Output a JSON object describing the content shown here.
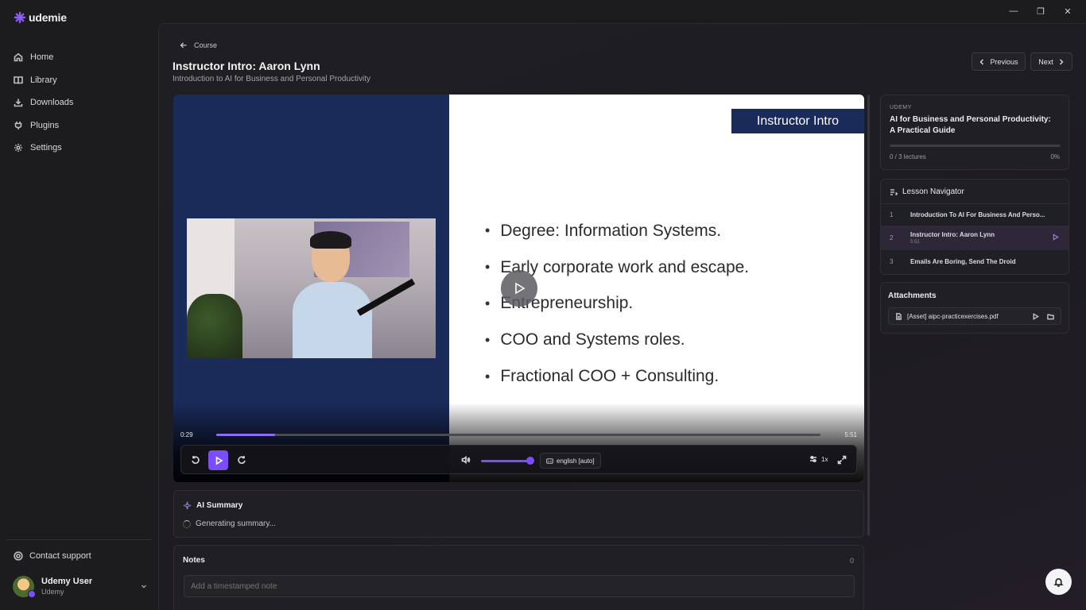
{
  "app": {
    "name": "udemie",
    "brand_color": "#7c4dff"
  },
  "window_controls": {
    "minimize": "—",
    "restore": "❐",
    "close": "✕"
  },
  "sidebar": {
    "items": [
      {
        "label": "Home",
        "icon": "home-icon"
      },
      {
        "label": "Library",
        "icon": "book-icon"
      },
      {
        "label": "Downloads",
        "icon": "download-icon"
      },
      {
        "label": "Plugins",
        "icon": "plug-icon"
      },
      {
        "label": "Settings",
        "icon": "gear-icon"
      }
    ],
    "support_label": "Contact support",
    "user": {
      "name": "Udemy User",
      "sub": "Udemy"
    }
  },
  "header": {
    "breadcrumb": "Course",
    "title": "Instructor Intro: Aaron Lynn",
    "subtitle": "Introduction to AI for Business and Personal Productivity",
    "prev_label": "Previous",
    "next_label": "Next"
  },
  "player": {
    "slide_banner": "Instructor Intro",
    "bullets": [
      "Degree: Information Systems.",
      "Early corporate work and escape.",
      "Entrepreneurship.",
      "COO and Systems roles.",
      "Fractional COO + Consulting."
    ],
    "current_time": "0:29",
    "duration": "5:51",
    "progress": 0.097,
    "volume": 1.0,
    "language": "english [auto]",
    "speed": "1x"
  },
  "ai_summary": {
    "title": "AI Summary",
    "status": "Generating summary..."
  },
  "notes": {
    "title": "Notes",
    "count": "0",
    "placeholder": "Add a timestamped note"
  },
  "course": {
    "kicker": "UDEMY",
    "title": "AI for Business and Personal Productivity: A Practical Guide",
    "lectures": "0 / 3 lectures",
    "percent": "0%",
    "progress": 0.0
  },
  "lesson_navigator": {
    "title": "Lesson Navigator",
    "lessons": [
      {
        "num": "1",
        "title": "Introduction To AI For Business And Perso...",
        "duration": ""
      },
      {
        "num": "2",
        "title": "Instructor Intro: Aaron Lynn",
        "duration": "5:51"
      },
      {
        "num": "3",
        "title": "Emails Are Boring, Send The Droid",
        "duration": ""
      }
    ]
  },
  "attachments": {
    "title": "Attachments",
    "items": [
      {
        "name": "[Asset] aipc-practicexercises.pdf"
      }
    ]
  }
}
